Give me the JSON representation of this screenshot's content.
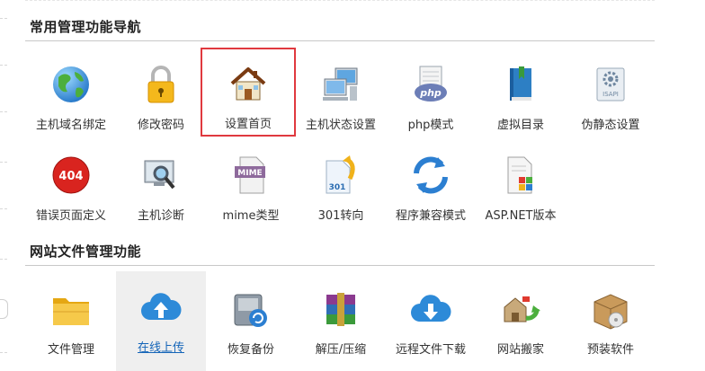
{
  "sections": [
    {
      "title": "常用管理功能导航",
      "items": [
        {
          "label": "主机域名绑定",
          "icon": "globe-icon"
        },
        {
          "label": "修改密码",
          "icon": "padlock-icon"
        },
        {
          "label": "设置首页",
          "icon": "house-icon",
          "selected": true
        },
        {
          "label": "主机状态设置",
          "icon": "computers-icon"
        },
        {
          "label": "php模式",
          "icon": "php-icon"
        },
        {
          "label": "虚拟目录",
          "icon": "book-icon"
        },
        {
          "label": "伪静态设置",
          "icon": "isapi-icon"
        },
        {
          "label": "错误页面定义",
          "icon": "error-404-icon"
        },
        {
          "label": "主机诊断",
          "icon": "monitor-magnifier-icon"
        },
        {
          "label": "mime类型",
          "icon": "mime-file-icon"
        },
        {
          "label": "301转向",
          "icon": "redirect-301-icon"
        },
        {
          "label": "程序兼容模式",
          "icon": "refresh-arrows-icon"
        },
        {
          "label": "ASP.NET版本",
          "icon": "document-grid-icon"
        }
      ]
    },
    {
      "title": "网站文件管理功能",
      "items": [
        {
          "label": "文件管理",
          "icon": "folder-icon"
        },
        {
          "label": "在线上传",
          "icon": "cloud-upload-icon",
          "hover": true
        },
        {
          "label": "恢复备份",
          "icon": "backup-drive-icon"
        },
        {
          "label": "解压/压缩",
          "icon": "archive-books-icon"
        },
        {
          "label": "远程文件下载",
          "icon": "cloud-download-icon"
        },
        {
          "label": "网站搬家",
          "icon": "website-move-icon"
        },
        {
          "label": "预装软件",
          "icon": "software-box-icon"
        }
      ]
    }
  ]
}
